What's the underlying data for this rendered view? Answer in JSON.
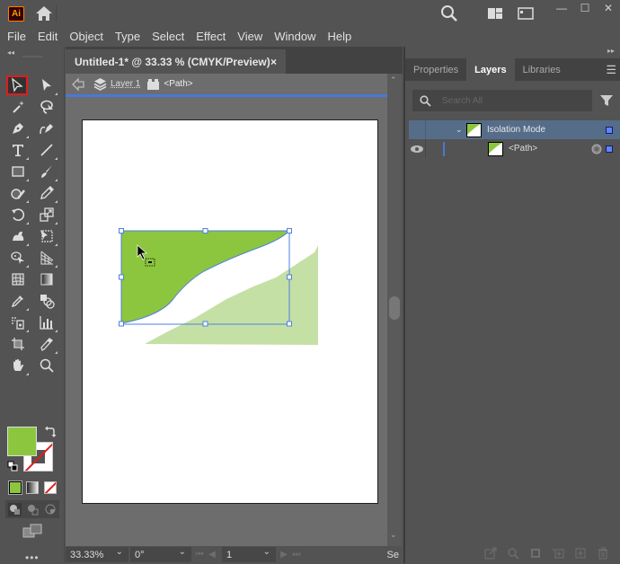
{
  "app": {
    "logo_text": "Ai",
    "brand_color": "#ff9a00",
    "window_controls": {
      "minimize": "—",
      "maximize": "☐",
      "close": "✕"
    }
  },
  "menu": [
    "File",
    "Edit",
    "Object",
    "Type",
    "Select",
    "Effect",
    "View",
    "Window",
    "Help"
  ],
  "document_tab": {
    "title": "Untitled-1* @ 33.33 % (CMYK/Preview)",
    "close": "×"
  },
  "isolation_bar": {
    "layer": "Layer 1",
    "object": "<Path>"
  },
  "tools": [
    "selection-tool",
    "direct-selection-tool",
    "magic-wand-tool",
    "lasso-tool",
    "pen-tool",
    "curvature-tool",
    "type-tool",
    "line-segment-tool",
    "rectangle-tool",
    "paintbrush-tool",
    "shaper-tool",
    "eraser-tool",
    "rotate-tool",
    "scale-tool",
    "puppet-warp-tool",
    "free-transform-tool",
    "shape-builder-tool",
    "perspective-grid-tool",
    "mesh-tool",
    "gradient-tool",
    "eyedropper-tool",
    "blend-tool",
    "symbol-sprayer-tool",
    "column-graph-tool",
    "artboard-tool",
    "slice-tool",
    "hand-tool",
    "zoom-tool"
  ],
  "colors": {
    "fill": "#8cc63f",
    "stroke": "none",
    "accent": "#4a78d8",
    "selection": "#4f7fe0",
    "shape_light": "#c5e0a5"
  },
  "toolbar_more": "•••",
  "status": {
    "zoom": "33.33%",
    "rotation": "0°",
    "artboard": "1",
    "overflow": "Se"
  },
  "panel": {
    "tabs": [
      "Properties",
      "Layers",
      "Libraries"
    ],
    "active_tab": "Layers",
    "search_placeholder": "Search All",
    "layers": [
      {
        "name": "Isolation Mode",
        "expanded": true
      },
      {
        "name": "<Path>",
        "visible": true
      }
    ]
  }
}
